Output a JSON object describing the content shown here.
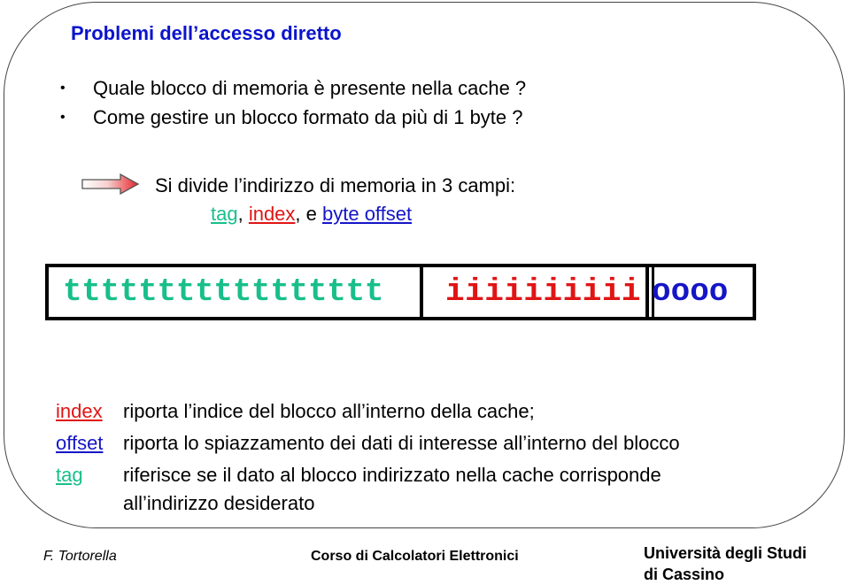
{
  "slide": {
    "title": "Problemi dell’accesso diretto",
    "bullets": [
      "Quale blocco di memoria è presente nella cache ?",
      "Come gestire un blocco formato da più di 1 byte ?"
    ],
    "bullet_glyph": "•",
    "arrow_icon": "right-arrow-icon",
    "divide_text": "Si divide l’indirizzo di memoria in 3 campi:",
    "fields": {
      "tag": "tag",
      "sep1": ", ",
      "index": "index",
      "sep2": ", e ",
      "offset": "byte offset"
    },
    "address": {
      "tag_bits": "ttttttttttttttttt",
      "index_bits": "iiiiiiiiii",
      "offset_bits": "oooo"
    },
    "definitions": [
      {
        "key": "index",
        "text": "riporta l’indice del blocco all’interno della cache;"
      },
      {
        "key": "offset",
        "text": "riporta lo spiazzamento dei dati di interesse all’interno del blocco"
      },
      {
        "key": "tag",
        "text": "riferisce se il dato al blocco indirizzato nella cache corrisponde",
        "text2": "all’indirizzo desiderato"
      }
    ]
  },
  "footer": {
    "author": "F. Tortorella",
    "course": "Corso di Calcolatori Elettronici",
    "university_line1": "Università degli Studi",
    "university_line2": "di Cassino"
  },
  "colors": {
    "title": "#0a14cc",
    "tag": "#18bf8a",
    "index": "#e01515",
    "offset": "#1515c8"
  }
}
